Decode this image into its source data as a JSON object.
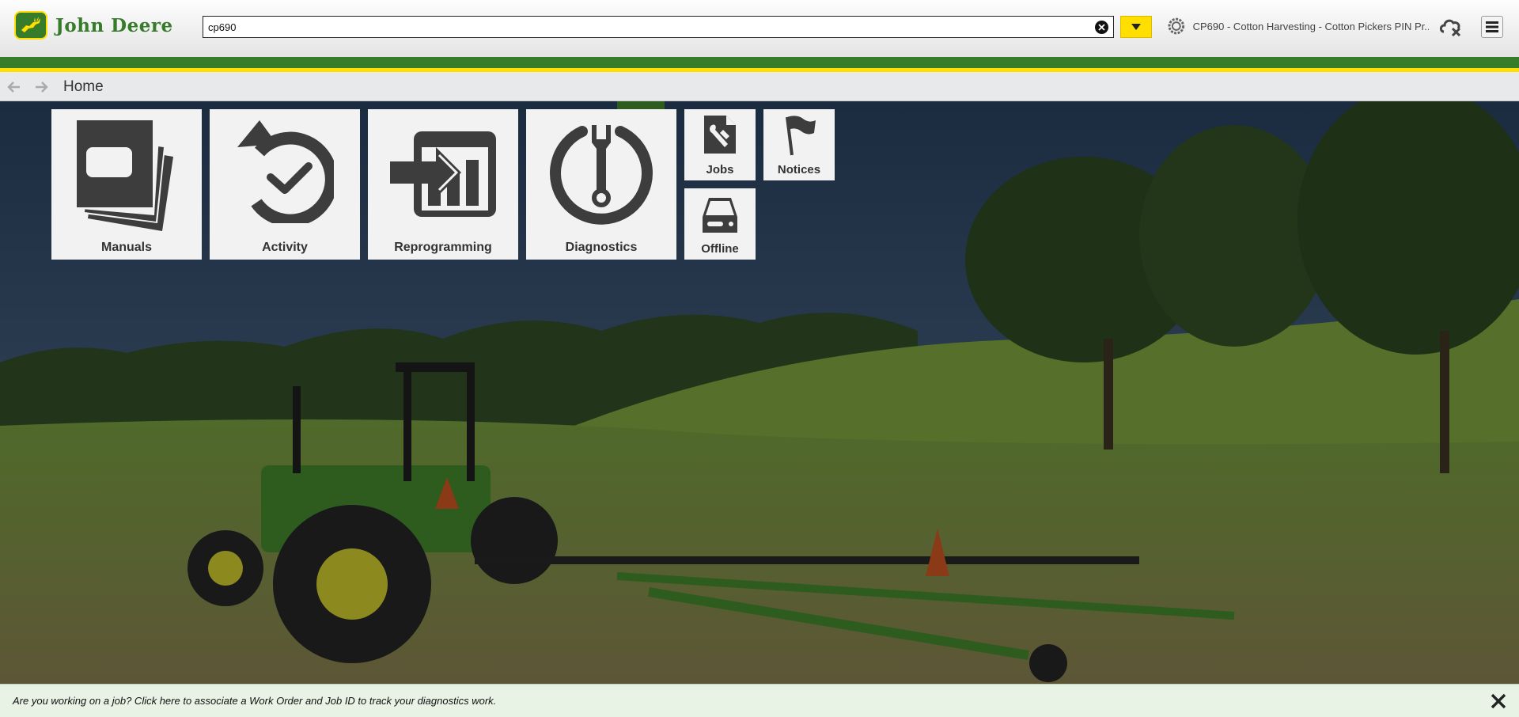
{
  "header": {
    "brand_name": "John Deere",
    "brand_color": "#367c2b",
    "accent_color": "#ffde00",
    "search": {
      "value": "cp690",
      "placeholder": ""
    },
    "machine_label": "CP690 - Cotton Harvesting - Cotton Pickers PIN Pr...",
    "icons": {
      "logo": "deer-logo-icon",
      "clear": "clear-search-icon",
      "dropdown": "chevron-down-icon",
      "machine": "gear-icon",
      "cloud": "cloud-offline-icon",
      "menu": "hamburger-menu-icon"
    }
  },
  "nav": {
    "page_title": "Home",
    "back_icon": "arrow-left-icon",
    "forward_icon": "arrow-right-icon"
  },
  "tiles": [
    {
      "label": "Manuals",
      "icon": "manuals-icon"
    },
    {
      "label": "Activity",
      "icon": "activity-history-icon"
    },
    {
      "label": "Reprogramming",
      "icon": "reprogramming-icon"
    },
    {
      "label": "Diagnostics",
      "icon": "diagnostics-wrench-icon"
    },
    {
      "label": "Jobs",
      "icon": "jobs-document-wrench-icon"
    },
    {
      "label": "Notices",
      "icon": "flag-icon"
    },
    {
      "label": "Offline",
      "icon": "offline-drive-icon"
    }
  ],
  "footer": {
    "message": "Are you working on a job? Click here to associate a Work Order and Job ID to track your diagnostics work.",
    "close_icon": "close-icon"
  }
}
